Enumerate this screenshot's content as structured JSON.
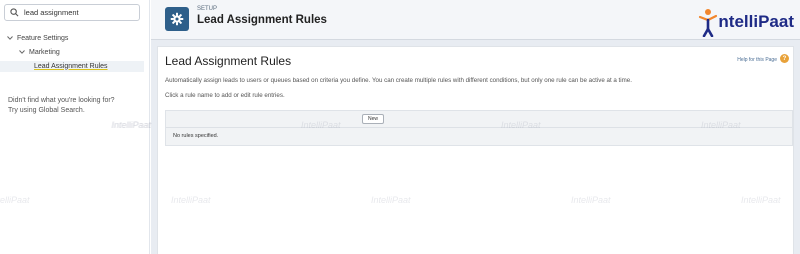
{
  "sidebar": {
    "search_value": "lead assignment",
    "tree": {
      "group_label": "Feature Settings",
      "subgroup_label": "Marketing",
      "active_item_label": "Lead Assignment Rules"
    },
    "hint_line1": "Didn't find what you're looking for?",
    "hint_line2": "Try using Global Search."
  },
  "header": {
    "breadcrumb": "SETUP",
    "title": "Lead Assignment Rules"
  },
  "logo": {
    "text": "ntelliPaat"
  },
  "content": {
    "title": "Lead Assignment Rules",
    "help_link": "Help for this Page",
    "help_icon": "?",
    "description": "Automatically assign leads to users or queues based on criteria you define. You can create multiple rules with different conditions, but only one rule can be active at a time.",
    "instruction": "Click a rule name to add or edit rule entries.",
    "new_button": "New",
    "empty_message": "No rules specified."
  },
  "watermark": "IntelliPaat",
  "colors": {
    "setup_icon_bg": "#2e5f8a",
    "logo_text": "#1f2b86",
    "help_icon": "#e8a23a"
  },
  "icons": [
    "search-icon",
    "chevron-down-icon",
    "gear-icon",
    "help-icon"
  ]
}
